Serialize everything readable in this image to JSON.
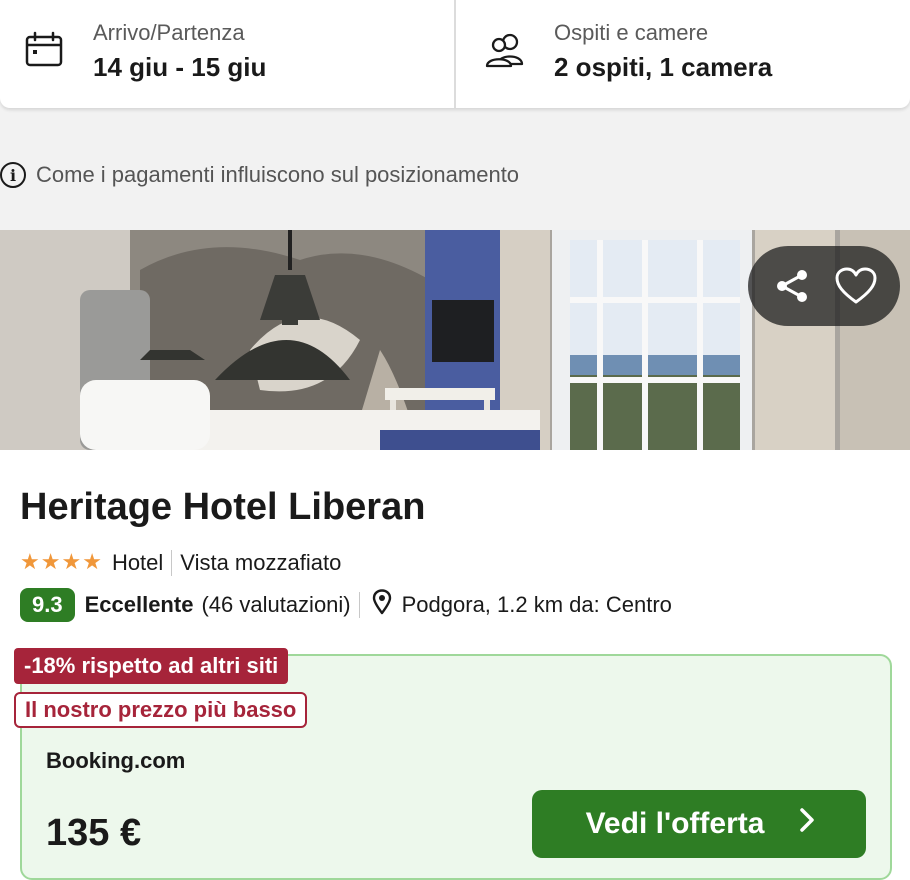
{
  "search": {
    "dates_label": "Arrivo/Partenza",
    "dates_value": "14 giu - 15 giu",
    "guests_label": "Ospiti e camere",
    "guests_value": "2 ospiti, 1 camera"
  },
  "notice": {
    "text": "Come i pagamenti influiscono sul posizionamento",
    "icon": "info-icon"
  },
  "hotel": {
    "name": "Heritage Hotel Liberan",
    "stars": 4,
    "type": "Hotel",
    "feature": "Vista mozzafiato",
    "score": "9.3",
    "rating_word": "Eccellente",
    "rating_count": "(46 valutazioni)",
    "location": "Podgora, 1.2 km da: Centro"
  },
  "deal": {
    "discount_badge": "-18% rispetto ad altri siti",
    "lowest_badge": "Il nostro prezzo più basso",
    "provider": "Booking.com",
    "price": "135 €",
    "cta_label": "Vedi l'offerta"
  },
  "colors": {
    "accent_green": "#2e7d24",
    "deal_bg": "#edf8ec",
    "discount_red": "#a6243a",
    "star_orange": "#f0973a"
  }
}
